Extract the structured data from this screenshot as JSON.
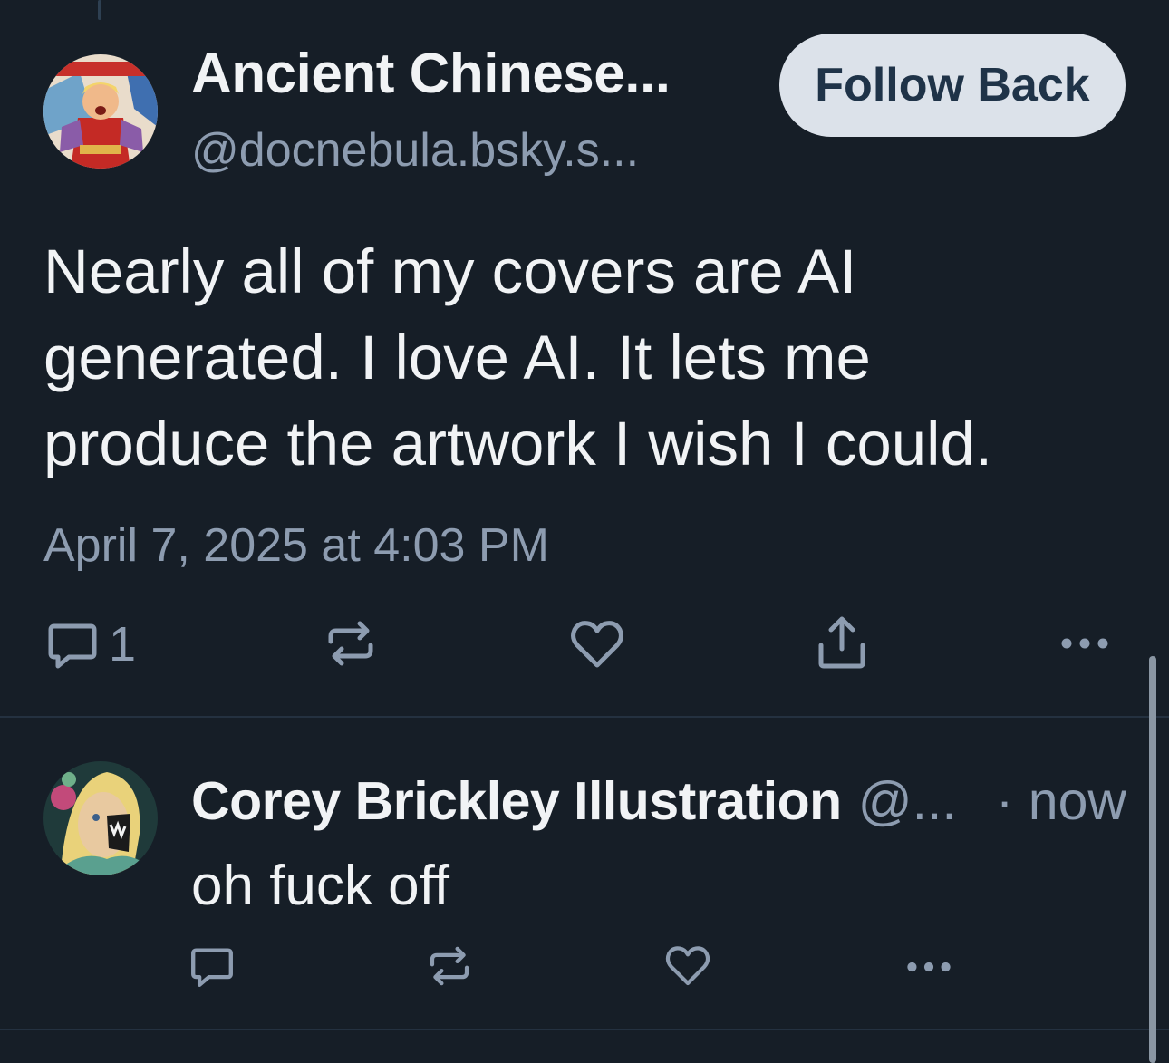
{
  "post": {
    "author_name": "Ancient Chinese...",
    "author_handle": "@docnebula.bsky.s...",
    "follow_label": "Follow Back",
    "text": "Nearly all of my covers are AI\ngenerated.  I love AI.  It lets me\nproduce the artwork I wish I could.",
    "timestamp": "April 7, 2025 at 4:03 PM",
    "reply_count": "1",
    "icons": [
      "reply-icon",
      "repost-icon",
      "like-icon",
      "share-icon",
      "more-icon"
    ]
  },
  "reply": {
    "author_name": "Corey Brickley Illustration",
    "author_handle": "@...",
    "time": "· now",
    "text": "oh fuck off",
    "icons": [
      "reply-icon",
      "repost-icon",
      "like-icon",
      "more-icon"
    ]
  },
  "colors": {
    "background": "#161e27",
    "text_primary": "#f1f3f5",
    "text_secondary": "#8d9cb0",
    "follow_button_bg": "#dce2ea",
    "follow_button_text": "#1f3348",
    "divider": "#243140"
  }
}
